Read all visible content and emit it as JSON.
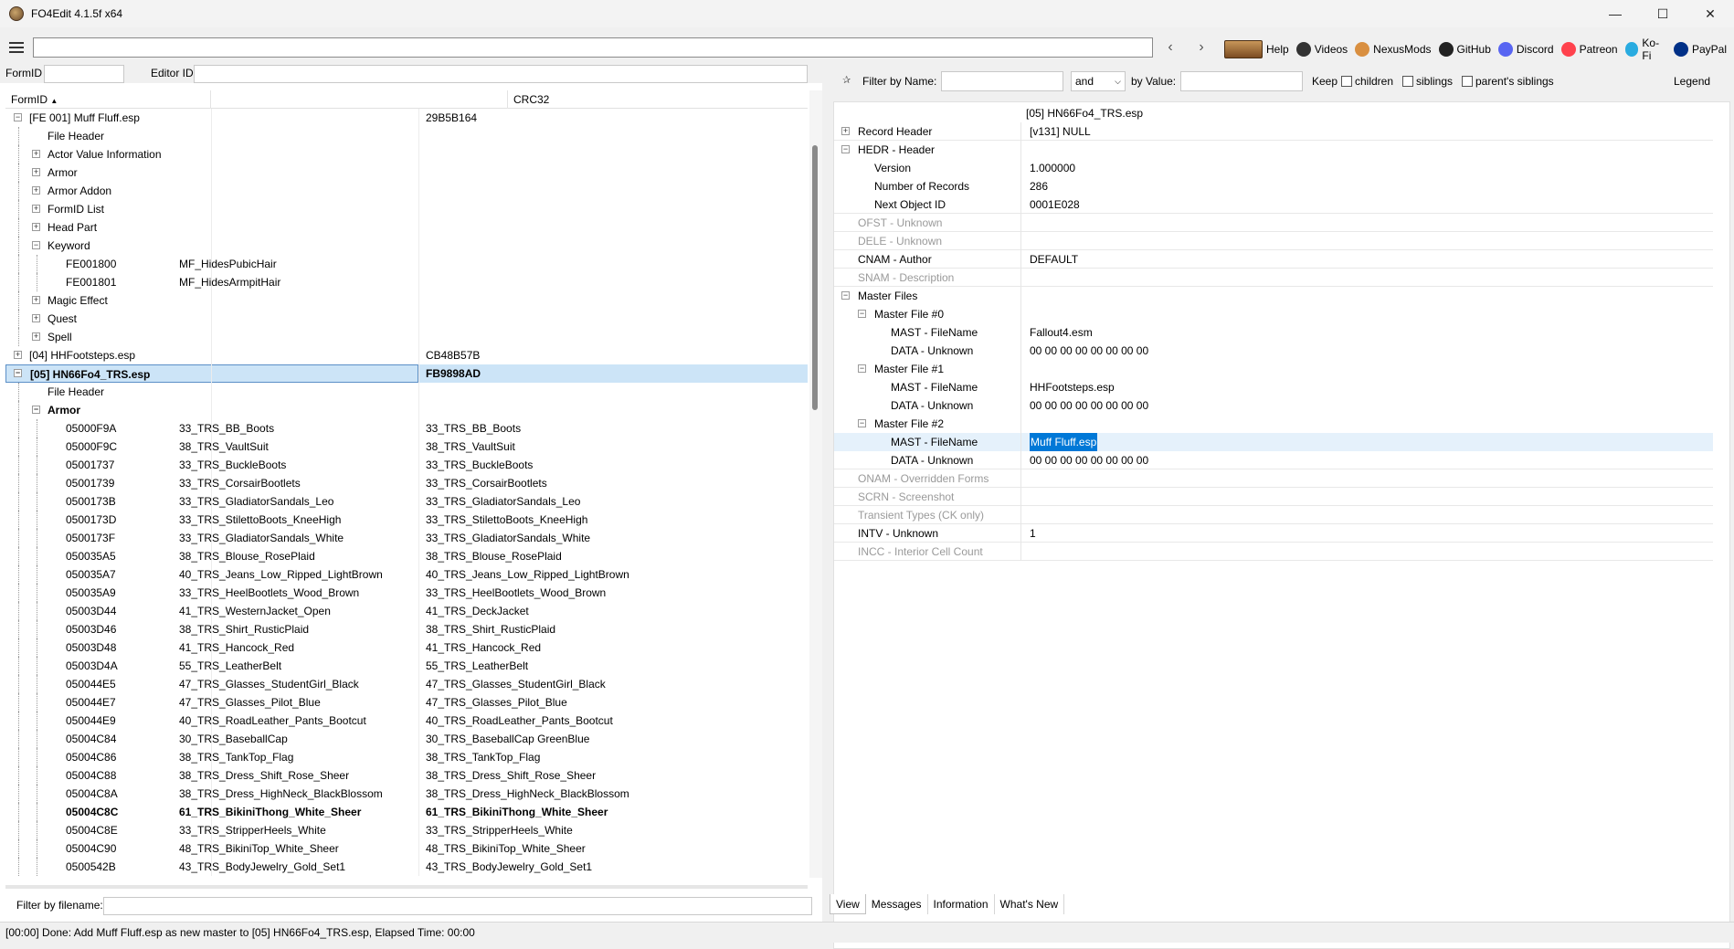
{
  "window": {
    "title": "FO4Edit 4.1.5f x64",
    "minimize": "—",
    "maximize": "☐",
    "close": "✕"
  },
  "toolbar": {
    "back": "‹",
    "forward": "›",
    "links": [
      {
        "label": "Help",
        "icon": "book-icon"
      },
      {
        "label": "Videos",
        "icon": "film-reel-icon"
      },
      {
        "label": "NexusMods",
        "icon": "nexusmods-icon"
      },
      {
        "label": "GitHub",
        "icon": "github-icon"
      },
      {
        "label": "Discord",
        "icon": "discord-icon"
      },
      {
        "label": "Patreon",
        "icon": "patreon-icon"
      },
      {
        "label": "Ko-Fi",
        "icon": "kofi-icon"
      },
      {
        "label": "PayPal",
        "icon": "paypal-icon"
      }
    ]
  },
  "left": {
    "formid_label": "FormID",
    "editorid_label": "Editor ID",
    "columns": [
      "FormID",
      "",
      "CRC32"
    ],
    "filter_label": "Filter by filename:",
    "rows": [
      {
        "level": 0,
        "exp": "−",
        "c1": "[FE 001] Muff Fluff.esp",
        "c2": "",
        "c3": "29B5B164"
      },
      {
        "level": 1,
        "exp": "",
        "c1": "File Header",
        "c2": "",
        "c3": ""
      },
      {
        "level": 1,
        "exp": "+",
        "c1": "Actor Value Information",
        "c2": "",
        "c3": ""
      },
      {
        "level": 1,
        "exp": "+",
        "c1": "Armor",
        "c2": "",
        "c3": ""
      },
      {
        "level": 1,
        "exp": "+",
        "c1": "Armor Addon",
        "c2": "",
        "c3": ""
      },
      {
        "level": 1,
        "exp": "+",
        "c1": "FormID List",
        "c2": "",
        "c3": ""
      },
      {
        "level": 1,
        "exp": "+",
        "c1": "Head Part",
        "c2": "",
        "c3": ""
      },
      {
        "level": 1,
        "exp": "−",
        "c1": "Keyword",
        "c2": "",
        "c3": ""
      },
      {
        "level": 2,
        "exp": "",
        "c1": "FE001800",
        "c2": "MF_HidesPubicHair",
        "c3": ""
      },
      {
        "level": 2,
        "exp": "",
        "c1": "FE001801",
        "c2": "MF_HidesArmpitHair",
        "c3": ""
      },
      {
        "level": 1,
        "exp": "+",
        "c1": "Magic Effect",
        "c2": "",
        "c3": ""
      },
      {
        "level": 1,
        "exp": "+",
        "c1": "Quest",
        "c2": "",
        "c3": ""
      },
      {
        "level": 1,
        "exp": "+",
        "c1": "Spell",
        "c2": "",
        "c3": ""
      },
      {
        "level": 0,
        "exp": "+",
        "c1": "[04] HHFootsteps.esp",
        "c2": "",
        "c3": "CB48B57B"
      },
      {
        "level": 0,
        "exp": "−",
        "c1": "[05] HN66Fo4_TRS.esp",
        "c2": "",
        "c3": "FB9898AD",
        "sel": true,
        "bold": true
      },
      {
        "level": 1,
        "exp": "",
        "c1": "File Header",
        "c2": "",
        "c3": ""
      },
      {
        "level": 1,
        "exp": "−",
        "c1": "Armor",
        "c2": "",
        "c3": "",
        "bold": true
      },
      {
        "level": 2,
        "exp": "",
        "c1": "05000F9A",
        "c2": "33_TRS_BB_Boots",
        "c3": "33_TRS_BB_Boots"
      },
      {
        "level": 2,
        "exp": "",
        "c1": "05000F9C",
        "c2": "38_TRS_VaultSuit",
        "c3": "38_TRS_VaultSuit"
      },
      {
        "level": 2,
        "exp": "",
        "c1": "05001737",
        "c2": "33_TRS_BuckleBoots",
        "c3": "33_TRS_BuckleBoots"
      },
      {
        "level": 2,
        "exp": "",
        "c1": "05001739",
        "c2": "33_TRS_CorsairBootlets",
        "c3": "33_TRS_CorsairBootlets"
      },
      {
        "level": 2,
        "exp": "",
        "c1": "0500173B",
        "c2": "33_TRS_GladiatorSandals_Leo",
        "c3": "33_TRS_GladiatorSandals_Leo"
      },
      {
        "level": 2,
        "exp": "",
        "c1": "0500173D",
        "c2": "33_TRS_StilettoBoots_KneeHigh",
        "c3": "33_TRS_StilettoBoots_KneeHigh"
      },
      {
        "level": 2,
        "exp": "",
        "c1": "0500173F",
        "c2": "33_TRS_GladiatorSandals_White",
        "c3": "33_TRS_GladiatorSandals_White"
      },
      {
        "level": 2,
        "exp": "",
        "c1": "050035A5",
        "c2": "38_TRS_Blouse_RosePlaid",
        "c3": "38_TRS_Blouse_RosePlaid"
      },
      {
        "level": 2,
        "exp": "",
        "c1": "050035A7",
        "c2": "40_TRS_Jeans_Low_Ripped_LightBrown",
        "c3": "40_TRS_Jeans_Low_Ripped_LightBrown"
      },
      {
        "level": 2,
        "exp": "",
        "c1": "050035A9",
        "c2": "33_TRS_HeelBootlets_Wood_Brown",
        "c3": "33_TRS_HeelBootlets_Wood_Brown"
      },
      {
        "level": 2,
        "exp": "",
        "c1": "05003D44",
        "c2": "41_TRS_WesternJacket_Open",
        "c3": "41_TRS_DeckJacket"
      },
      {
        "level": 2,
        "exp": "",
        "c1": "05003D46",
        "c2": "38_TRS_Shirt_RusticPlaid",
        "c3": "38_TRS_Shirt_RusticPlaid"
      },
      {
        "level": 2,
        "exp": "",
        "c1": "05003D48",
        "c2": "41_TRS_Hancock_Red",
        "c3": "41_TRS_Hancock_Red"
      },
      {
        "level": 2,
        "exp": "",
        "c1": "05003D4A",
        "c2": "55_TRS_LeatherBelt",
        "c3": "55_TRS_LeatherBelt"
      },
      {
        "level": 2,
        "exp": "",
        "c1": "050044E5",
        "c2": "47_TRS_Glasses_StudentGirl_Black",
        "c3": "47_TRS_Glasses_StudentGirl_Black"
      },
      {
        "level": 2,
        "exp": "",
        "c1": "050044E7",
        "c2": "47_TRS_Glasses_Pilot_Blue",
        "c3": "47_TRS_Glasses_Pilot_Blue"
      },
      {
        "level": 2,
        "exp": "",
        "c1": "050044E9",
        "c2": "40_TRS_RoadLeather_Pants_Bootcut",
        "c3": "40_TRS_RoadLeather_Pants_Bootcut"
      },
      {
        "level": 2,
        "exp": "",
        "c1": "05004C84",
        "c2": "30_TRS_BaseballCap",
        "c3": "30_TRS_BaseballCap GreenBlue"
      },
      {
        "level": 2,
        "exp": "",
        "c1": "05004C86",
        "c2": "38_TRS_TankTop_Flag",
        "c3": "38_TRS_TankTop_Flag"
      },
      {
        "level": 2,
        "exp": "",
        "c1": "05004C88",
        "c2": "38_TRS_Dress_Shift_Rose_Sheer",
        "c3": "38_TRS_Dress_Shift_Rose_Sheer"
      },
      {
        "level": 2,
        "exp": "",
        "c1": "05004C8A",
        "c2": "38_TRS_Dress_HighNeck_BlackBlossom",
        "c3": "38_TRS_Dress_HighNeck_BlackBlossom"
      },
      {
        "level": 2,
        "exp": "",
        "c1": "05004C8C",
        "c2": "61_TRS_BikiniThong_White_Sheer",
        "c3": "61_TRS_BikiniThong_White_Sheer",
        "bold": true
      },
      {
        "level": 2,
        "exp": "",
        "c1": "05004C8E",
        "c2": "33_TRS_StripperHeels_White",
        "c3": "33_TRS_StripperHeels_White"
      },
      {
        "level": 2,
        "exp": "",
        "c1": "05004C90",
        "c2": "48_TRS_BikiniTop_White_Sheer",
        "c3": "48_TRS_BikiniTop_White_Sheer"
      },
      {
        "level": 2,
        "exp": "",
        "c1": "0500542B",
        "c2": "43_TRS_BodyJewelry_Gold_Set1",
        "c3": "43_TRS_BodyJewelry_Gold_Set1"
      }
    ]
  },
  "right": {
    "filter_name_label": "Filter by Name:",
    "and_value": "and",
    "by_value_label": "by Value:",
    "keep_label": "Keep",
    "children_label": "children",
    "siblings_label": "siblings",
    "parents_siblings_label": "parent's siblings",
    "legend_label": "Legend",
    "header_file": "[05] HN66Fo4_TRS.esp",
    "rows": [
      {
        "level": 0,
        "exp": "+",
        "label": "Record Header",
        "value": "[v131] NULL",
        "line": true
      },
      {
        "level": 0,
        "exp": "−",
        "label": "HEDR - Header",
        "value": ""
      },
      {
        "level": 1,
        "exp": "",
        "label": "Version",
        "value": "1.000000"
      },
      {
        "level": 1,
        "exp": "",
        "label": "Number of Records",
        "value": "286"
      },
      {
        "level": 1,
        "exp": "",
        "label": "Next Object ID",
        "value": "0001E028",
        "line": true
      },
      {
        "level": 0,
        "exp": "",
        "label": "OFST - Unknown",
        "value": "",
        "gray": true,
        "line": true
      },
      {
        "level": 0,
        "exp": "",
        "label": "DELE - Unknown",
        "value": "",
        "gray": true,
        "line": true
      },
      {
        "level": 0,
        "exp": "",
        "label": "CNAM - Author",
        "value": "DEFAULT",
        "line": true
      },
      {
        "level": 0,
        "exp": "",
        "label": "SNAM - Description",
        "value": "",
        "gray": true,
        "line": true
      },
      {
        "level": 0,
        "exp": "−",
        "label": "Master Files",
        "value": ""
      },
      {
        "level": 1,
        "exp": "−",
        "label": "Master File #0",
        "value": ""
      },
      {
        "level": 2,
        "exp": "",
        "label": "MAST - FileName",
        "value": "Fallout4.esm"
      },
      {
        "level": 2,
        "exp": "",
        "label": "DATA - Unknown",
        "value": "00 00 00 00 00 00 00 00"
      },
      {
        "level": 1,
        "exp": "−",
        "label": "Master File #1",
        "value": ""
      },
      {
        "level": 2,
        "exp": "",
        "label": "MAST - FileName",
        "value": "HHFootsteps.esp"
      },
      {
        "level": 2,
        "exp": "",
        "label": "DATA - Unknown",
        "value": "00 00 00 00 00 00 00 00"
      },
      {
        "level": 1,
        "exp": "−",
        "label": "Master File #2",
        "value": ""
      },
      {
        "level": 2,
        "exp": "",
        "label": "MAST - FileName",
        "value": "Muff Fluff.esp",
        "hl": true
      },
      {
        "level": 2,
        "exp": "",
        "label": "DATA - Unknown",
        "value": "00 00 00 00 00 00 00 00",
        "line": true
      },
      {
        "level": 0,
        "exp": "",
        "label": "ONAM - Overridden Forms",
        "value": "",
        "gray": true,
        "line": true
      },
      {
        "level": 0,
        "exp": "",
        "label": "SCRN - Screenshot",
        "value": "",
        "gray": true,
        "line": true
      },
      {
        "level": 0,
        "exp": "",
        "label": "Transient Types (CK only)",
        "value": "",
        "gray": true,
        "line": true
      },
      {
        "level": 0,
        "exp": "",
        "label": "INTV - Unknown",
        "value": "1",
        "line": true
      },
      {
        "level": 0,
        "exp": "",
        "label": "INCC - Interior Cell Count",
        "value": "",
        "gray": true,
        "line": true
      }
    ],
    "tabs": [
      "View",
      "Messages",
      "Information",
      "What's New"
    ]
  },
  "status": "[00:00] Done: Add Muff Fluff.esp as new master to [05] HN66Fo4_TRS.esp, Elapsed Time: 00:00"
}
